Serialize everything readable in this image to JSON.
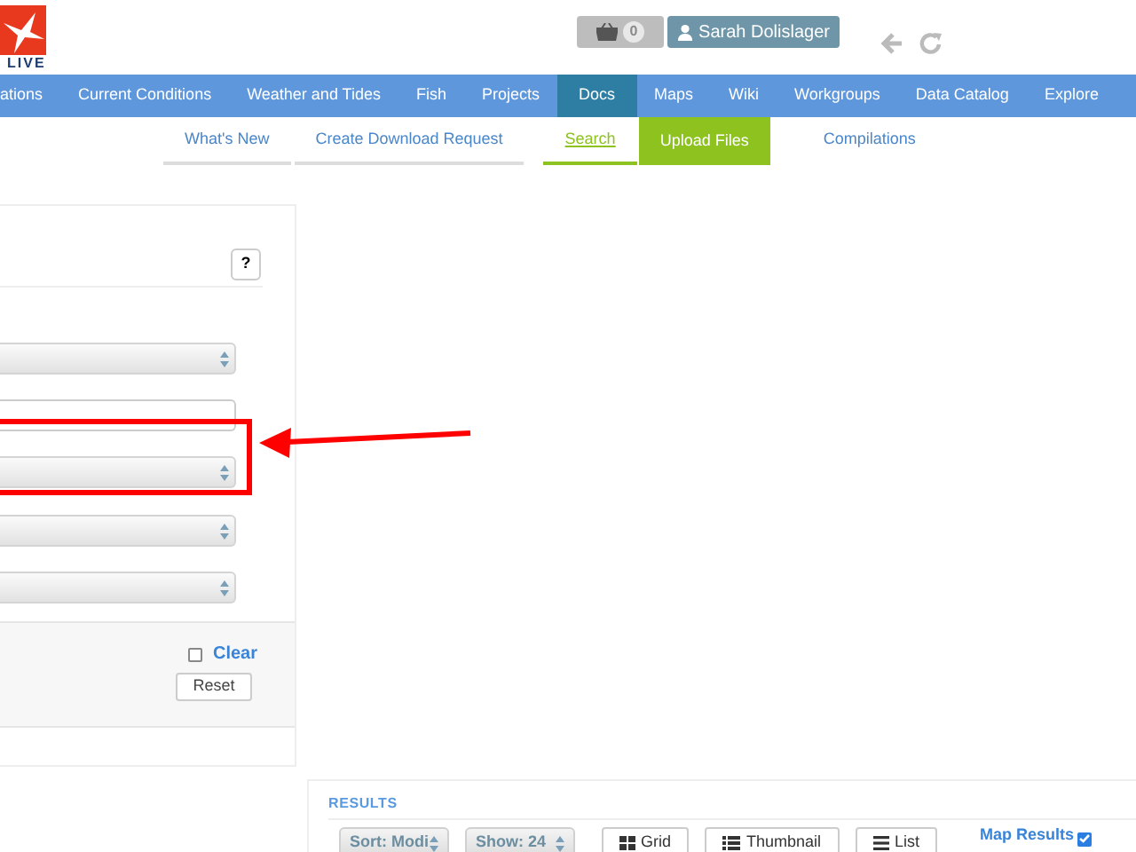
{
  "header": {
    "logo_text": "LIVE",
    "cart_count": "0",
    "user": "Sarah Dolislager"
  },
  "nav": [
    {
      "label": "ations",
      "selected": false
    },
    {
      "label": "Current Conditions",
      "selected": false
    },
    {
      "label": "Weather and Tides",
      "selected": false
    },
    {
      "label": "Fish",
      "selected": false
    },
    {
      "label": "Projects",
      "selected": false
    },
    {
      "label": "Docs",
      "selected": true
    },
    {
      "label": "Maps",
      "selected": false
    },
    {
      "label": "Wiki",
      "selected": false
    },
    {
      "label": "Workgroups",
      "selected": false
    },
    {
      "label": "Data Catalog",
      "selected": false
    },
    {
      "label": "Explore",
      "selected": false
    }
  ],
  "subnav": [
    {
      "label": "What's New",
      "kind": "link",
      "selected": false
    },
    {
      "label": "Create Download Request",
      "kind": "link",
      "selected": false
    },
    {
      "label": "Search",
      "kind": "link",
      "selected": true
    },
    {
      "label": "Upload Files",
      "kind": "button",
      "selected": false
    },
    {
      "label": "Compilations",
      "kind": "link",
      "selected": false
    }
  ],
  "filter_panel": {
    "help": "?",
    "fields": [
      {
        "kind": "select"
      },
      {
        "kind": "input"
      },
      {
        "kind": "select",
        "highlighted": true
      },
      {
        "kind": "select",
        "highlighted": false
      },
      {
        "kind": "select",
        "highlighted": false
      }
    ],
    "clear": {
      "label": "Clear",
      "checked": false
    },
    "reset": "Reset"
  },
  "results": {
    "title": "RESULTS",
    "sort": "Sort: Modi",
    "show": "Show: 24",
    "views": [
      {
        "label": "Grid",
        "kind": "grid"
      },
      {
        "label": "Thumbnail",
        "kind": "thumbnail"
      },
      {
        "label": "List",
        "kind": "list"
      }
    ],
    "map_results": {
      "label": "Map Results",
      "checked": true
    }
  }
}
